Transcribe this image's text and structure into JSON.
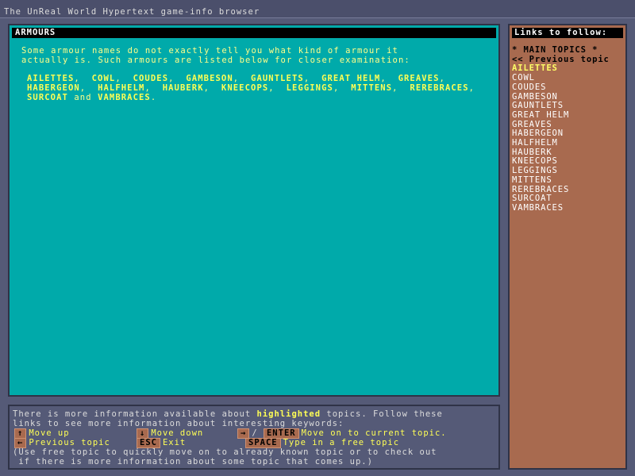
{
  "window": {
    "title": "The UnReal World Hypertext game-info browser"
  },
  "main": {
    "heading": "ARMOURS",
    "paragraph_lines": [
      "Some armour names do not exactly tell you what kind of armour it",
      "actually is. Such armours are listed below for closer examination:"
    ],
    "link_rows": [
      [
        "AILETTES",
        "COWL",
        "COUDES",
        "GAMBESON",
        "GAUNTLETS",
        "GREAT HELM",
        "GREAVES"
      ],
      [
        "HABERGEON",
        "HALFHELM",
        "HAUBERK",
        "KNEECOPS",
        "LEGGINGS",
        "MITTENS",
        "REREBRACES"
      ],
      [
        "SURCOAT",
        "VAMBRACES"
      ]
    ],
    "link_separator": ",",
    "and_word": "and",
    "end_mark": "."
  },
  "sidebar": {
    "heading": "Links to follow:",
    "nav_items": [
      "* MAIN TOPICS *",
      "<< Previous topic"
    ],
    "items": [
      "AILETTES",
      "COWL",
      "COUDES",
      "GAMBESON",
      "GAUNTLETS",
      "GREAT HELM",
      "GREAVES",
      "HABERGEON",
      "HALFHELM",
      "HAUBERK",
      "KNEECOPS",
      "LEGGINGS",
      "MITTENS",
      "REREBRACES",
      "SURCOAT",
      "VAMBRACES"
    ],
    "active_index": 0
  },
  "help": {
    "intro_a": "There is more information available about ",
    "intro_highlight": "highlighted",
    "intro_b": " topics. Follow these",
    "intro_line2": "links to see more information about interesting keywords:",
    "key_up": "↑",
    "label_up": "Move up",
    "key_down": "↓",
    "label_down": "Move down",
    "key_right": "→",
    "slash": "/",
    "key_enter": "ENTER",
    "label_enter": "Move on to current topic.",
    "key_left": "←",
    "label_left": "Previous topic",
    "key_esc": "ESC",
    "label_esc": "Exit",
    "key_space": "SPACE",
    "label_space": "Type in a free topic",
    "note_line1": "(Use free topic to quickly move on to already known topic or to check out",
    "note_line2": " if there is more information about some topic that comes up.)"
  },
  "colors": {
    "main_bg": "#00aaaa",
    "sidebar_bg": "#a86a4f",
    "window_bg": "#555a77",
    "highlight": "#ffff55"
  }
}
